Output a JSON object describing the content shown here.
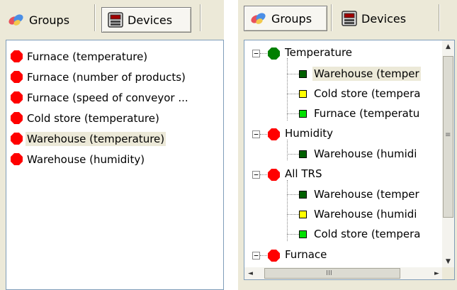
{
  "left_panel": {
    "tabs": [
      {
        "label": "Groups",
        "icon": "groups-icon",
        "active": false
      },
      {
        "label": "Devices",
        "icon": "devices-icon",
        "active": true
      }
    ],
    "items": [
      {
        "label": "Furnace (temperature)",
        "status_color": "#ff0000",
        "selected": false
      },
      {
        "label": "Furnace (number of products)",
        "status_color": "#ff0000",
        "selected": false
      },
      {
        "label": "Furnace (speed of conveyor ...",
        "status_color": "#ff0000",
        "selected": false
      },
      {
        "label": "Cold store (temperature)",
        "status_color": "#ff0000",
        "selected": false
      },
      {
        "label": "Warehouse (temperature)",
        "status_color": "#ff0000",
        "selected": true
      },
      {
        "label": "Warehouse (humidity)",
        "status_color": "#ff0000",
        "selected": false
      }
    ]
  },
  "right_panel": {
    "tabs": [
      {
        "label": "Groups",
        "icon": "groups-icon",
        "active": true
      },
      {
        "label": "Devices",
        "icon": "devices-icon",
        "active": false
      }
    ],
    "tree": [
      {
        "label": "Temperature",
        "status_color": "#008000",
        "expanded": true,
        "expander": "−",
        "children": [
          {
            "label": "Warehouse (temper",
            "color": "#006000",
            "selected": true
          },
          {
            "label": "Cold store (tempera",
            "color": "#ffff00",
            "selected": false
          },
          {
            "label": "Furnace (temperatu",
            "color": "#00e000",
            "selected": false
          }
        ]
      },
      {
        "label": "Humidity",
        "status_color": "#ff0000",
        "expanded": true,
        "expander": "−",
        "children": [
          {
            "label": "Warehouse (humidi",
            "color": "#006000",
            "selected": false
          }
        ]
      },
      {
        "label": "All TRS",
        "status_color": "#ff0000",
        "expanded": true,
        "expander": "−",
        "children": [
          {
            "label": "Warehouse (temper",
            "color": "#006000",
            "selected": false
          },
          {
            "label": "Warehouse (humidi",
            "color": "#ffff00",
            "selected": false
          },
          {
            "label": "Cold store (tempera",
            "color": "#00e000",
            "selected": false
          }
        ]
      },
      {
        "label": "Furnace",
        "status_color": "#ff0000",
        "expanded": true,
        "expander": "−",
        "children": []
      }
    ],
    "scrollbar_glyphs": {
      "up": "▲",
      "down": "▼",
      "left": "◄",
      "right": "►",
      "grip_v": "≡",
      "grip_h": "III"
    }
  }
}
